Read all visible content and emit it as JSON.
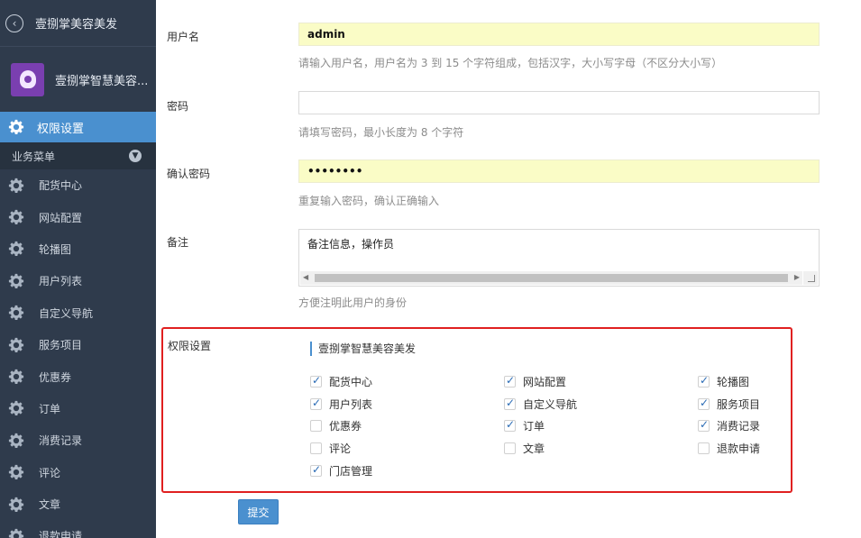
{
  "sidebar": {
    "top_title": "壹捌掌美容美发",
    "profile_name": "壹捌掌智慧美容...",
    "active_item": "权限设置",
    "section_title": "业务菜单",
    "items": [
      {
        "label": "配货中心"
      },
      {
        "label": "网站配置"
      },
      {
        "label": "轮播图"
      },
      {
        "label": "用户列表"
      },
      {
        "label": "自定义导航"
      },
      {
        "label": "服务项目"
      },
      {
        "label": "优惠券"
      },
      {
        "label": "订单"
      },
      {
        "label": "消费记录"
      },
      {
        "label": "评论"
      },
      {
        "label": "文章"
      },
      {
        "label": "退款申请"
      }
    ]
  },
  "form": {
    "username": {
      "label": "用户名",
      "value": "admin",
      "hint": "请输入用户名，用户名为 3 到 15 个字符组成，包括汉字，大小写字母（不区分大小写）"
    },
    "password": {
      "label": "密码",
      "value": "",
      "hint": "请填写密码，最小长度为 8 个字符"
    },
    "confirm": {
      "label": "确认密码",
      "value": "••••••••",
      "hint": "重复输入密码，确认正确输入"
    },
    "remark": {
      "label": "备注",
      "value": "备注信息，操作员",
      "hint": "方便注明此用户的身份"
    },
    "permissions": {
      "label": "权限设置",
      "group_title": "壹捌掌智慧美容美发",
      "options": [
        {
          "label": "配货中心",
          "checked": true
        },
        {
          "label": "网站配置",
          "checked": true
        },
        {
          "label": "轮播图",
          "checked": true
        },
        {
          "label": "用户列表",
          "checked": true
        },
        {
          "label": "自定义导航",
          "checked": true
        },
        {
          "label": "服务项目",
          "checked": true
        },
        {
          "label": "优惠券",
          "checked": false
        },
        {
          "label": "订单",
          "checked": true
        },
        {
          "label": "消费记录",
          "checked": true
        },
        {
          "label": "评论",
          "checked": false
        },
        {
          "label": "文章",
          "checked": false
        },
        {
          "label": "退款申请",
          "checked": false
        },
        {
          "label": "门店管理",
          "checked": true
        }
      ]
    },
    "submit_label": "提交"
  },
  "colors": {
    "sidebar_bg": "#2f3b4c",
    "accent": "#4a90cf",
    "highlight_border": "#e02020",
    "autofill_bg": "#fafcc6"
  }
}
